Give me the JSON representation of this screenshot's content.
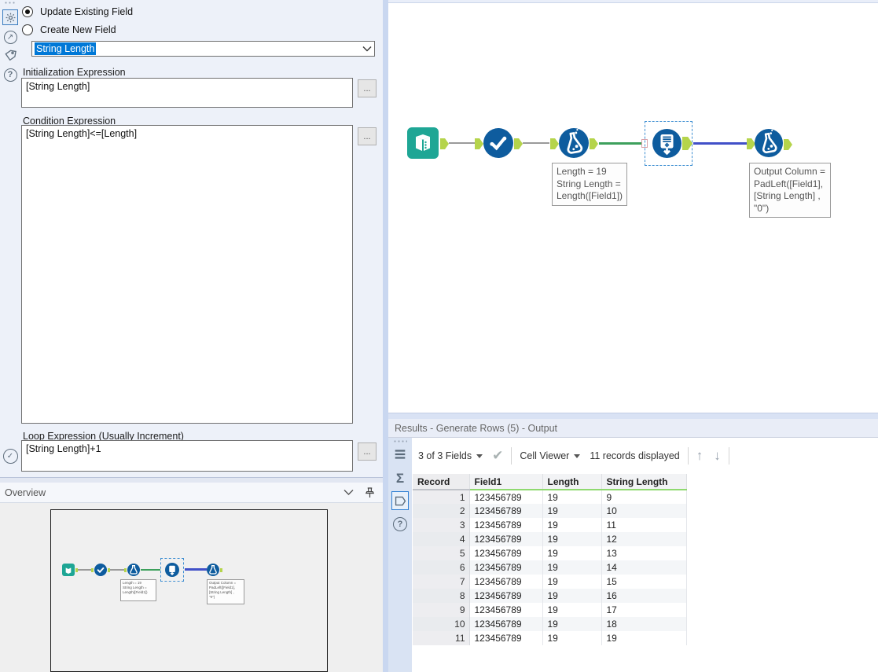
{
  "colors": {
    "accent_selection": "#0078d7",
    "tool_blue": "#0e5c9e",
    "input_tool_teal": "#1ea695",
    "anchor_green": "#b5d44b",
    "wire_green": "#3da05c",
    "wire_blue": "#4150c8",
    "header_underline_green": "#8fd96f",
    "selection_dash_blue": "#3f8fd2"
  },
  "config_panel": {
    "radio_update_label": "Update Existing Field",
    "radio_create_label": "Create New Field",
    "field_dropdown_value": "String Length",
    "init_label": "Initialization Expression",
    "init_value": "[String Length]",
    "condition_label": "Condition Expression",
    "condition_value": "[String Length]<=[Length]",
    "loop_label": "Loop Expression (Usually Increment)",
    "loop_value": "[String Length]+1",
    "ellipsis_button": "..."
  },
  "overview": {
    "title": "Overview"
  },
  "canvas": {
    "tools": [
      "input-data-tool",
      "select-tool",
      "formula-tool",
      "generate-rows-tool (selected)",
      "formula-tool"
    ],
    "annotations": [
      {
        "lines": [
          "Length = 19",
          "String Length =",
          "Length([Field1])"
        ]
      },
      {
        "lines": [
          "Output Column =",
          "PadLeft([Field1],",
          "[String Length] ,",
          "\"0\")"
        ]
      }
    ]
  },
  "results": {
    "title": "Results - Generate Rows (5) - Output",
    "fields_summary": "3 of 3 Fields",
    "cell_viewer_label": "Cell Viewer",
    "records_displayed": "11 records displayed",
    "table": {
      "columns": [
        "Record",
        "Field1",
        "Length",
        "String Length"
      ],
      "rows": [
        [
          "1",
          "123456789",
          "19",
          "9"
        ],
        [
          "2",
          "123456789",
          "19",
          "10"
        ],
        [
          "3",
          "123456789",
          "19",
          "11"
        ],
        [
          "4",
          "123456789",
          "19",
          "12"
        ],
        [
          "5",
          "123456789",
          "19",
          "13"
        ],
        [
          "6",
          "123456789",
          "19",
          "14"
        ],
        [
          "7",
          "123456789",
          "19",
          "15"
        ],
        [
          "8",
          "123456789",
          "19",
          "16"
        ],
        [
          "9",
          "123456789",
          "19",
          "17"
        ],
        [
          "10",
          "123456789",
          "19",
          "18"
        ],
        [
          "11",
          "123456789",
          "19",
          "19"
        ]
      ]
    }
  }
}
